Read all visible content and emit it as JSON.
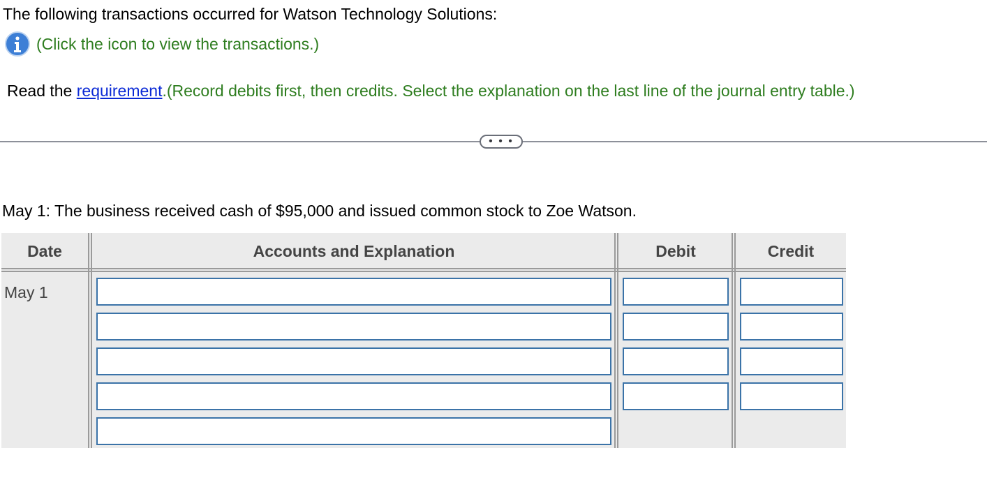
{
  "intro": {
    "text": "The following transactions occurred for Watson Technology Solutions:"
  },
  "info": {
    "icon": "info-icon",
    "text": "(Click the icon to view the transactions.)"
  },
  "requirement": {
    "prefix": "Read the ",
    "link_label": "requirement",
    "instructions": ".(Record debits first, then credits. Select the explanation on the last line of the journal entry table.)"
  },
  "more_button": {
    "label": "• • •"
  },
  "question": {
    "text": "May 1: The business received cash of $95,000 and issued common stock to Zoe Watson."
  },
  "journal": {
    "headers": {
      "date": "Date",
      "accounts": "Accounts and Explanation",
      "debit": "Debit",
      "credit": "Credit"
    },
    "date_value": "May 1",
    "rows": [
      {
        "account": "",
        "debit": "",
        "credit": ""
      },
      {
        "account": "",
        "debit": "",
        "credit": ""
      },
      {
        "account": "",
        "debit": "",
        "credit": ""
      },
      {
        "account": "",
        "debit": "",
        "credit": ""
      },
      {
        "explanation": ""
      }
    ]
  },
  "colors": {
    "green_text": "#2e7d1f",
    "link_blue": "#0b2ad6",
    "input_border": "#3b73a8",
    "table_bg": "#ebebeb",
    "info_icon_blue": "#3d7fd6"
  }
}
